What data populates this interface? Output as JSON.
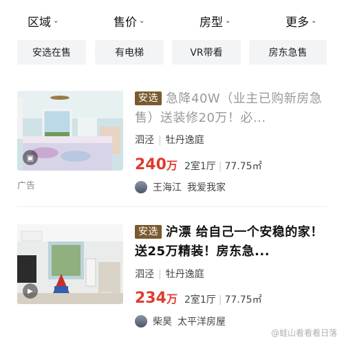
{
  "filters": [
    {
      "label": "区域",
      "chevron": "chevron-down-icon"
    },
    {
      "label": "售价",
      "chevron": "chevron-down-icon"
    },
    {
      "label": "房型",
      "chevron": "chevron-down-icon"
    },
    {
      "label": "更多",
      "chevron": "chevron-down-icon"
    }
  ],
  "tags": [
    "安选在售",
    "有电梯",
    "VR带看",
    "房东急售"
  ],
  "listings": [
    {
      "badge": "安选",
      "title": "急降40W（业主已购新房急售）送装修20万！必...",
      "district": "泗泾",
      "community": "牡丹逸庭",
      "price": "240",
      "price_unit": "万",
      "layout": "2室1厅",
      "area": "77.75㎡",
      "agent_name": "王海江",
      "agent_company": "我爱我家",
      "ad_label": "广告",
      "media_icon": "vr-icon"
    },
    {
      "badge": "安选",
      "title": "沪漂 给自己一个安稳的家！送25万精装！房东急...",
      "district": "泗泾",
      "community": "牡丹逸庭",
      "price": "234",
      "price_unit": "万",
      "layout": "2室1厅",
      "area": "77.75㎡",
      "agent_name": "柴昊",
      "agent_company": "太平洋房屋",
      "media_icon": "video-play-icon"
    }
  ],
  "watermark": "@蛙山看看看日落",
  "colors": {
    "price": "#e03b2f",
    "badge": "#7a5a2f",
    "tag_bg": "#f3f4f6"
  }
}
